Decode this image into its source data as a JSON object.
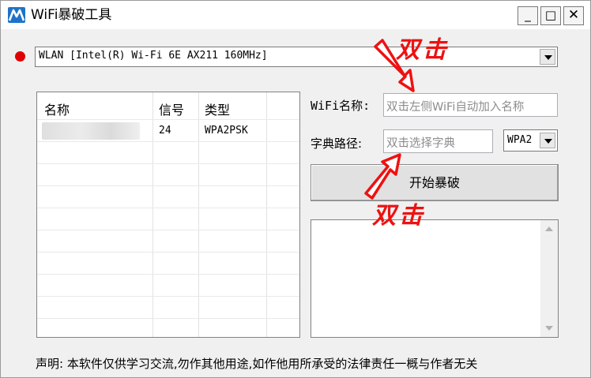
{
  "window": {
    "title": "WiFi暴破工具",
    "controls": {
      "minimize": "_",
      "maximize": "□",
      "close": "✕"
    }
  },
  "adapter": {
    "status_color": "#e00000",
    "selected": "WLAN [Intel(R) Wi-Fi 6E AX211 160MHz]"
  },
  "wifi_list": {
    "columns": [
      "名称",
      "信号",
      "类型"
    ],
    "rows": [
      {
        "signal": "24",
        "type": "WPA2PSK"
      }
    ]
  },
  "form": {
    "ssid_label": "WiFi名称:",
    "ssid_placeholder": "双击左侧WiFi自动加入名称",
    "dict_label": "字典路径:",
    "dict_placeholder": "双击选择字典",
    "security_selected": "WPA2",
    "start_button": "开始暴破"
  },
  "annotations": {
    "top": "双击",
    "bottom": "双击",
    "color": "#ee1111"
  },
  "footer": {
    "disclaimer": "声明: 本软件仅供学习交流,勿作其他用途,如作他用所承受的法律责任一概与作者无关"
  }
}
